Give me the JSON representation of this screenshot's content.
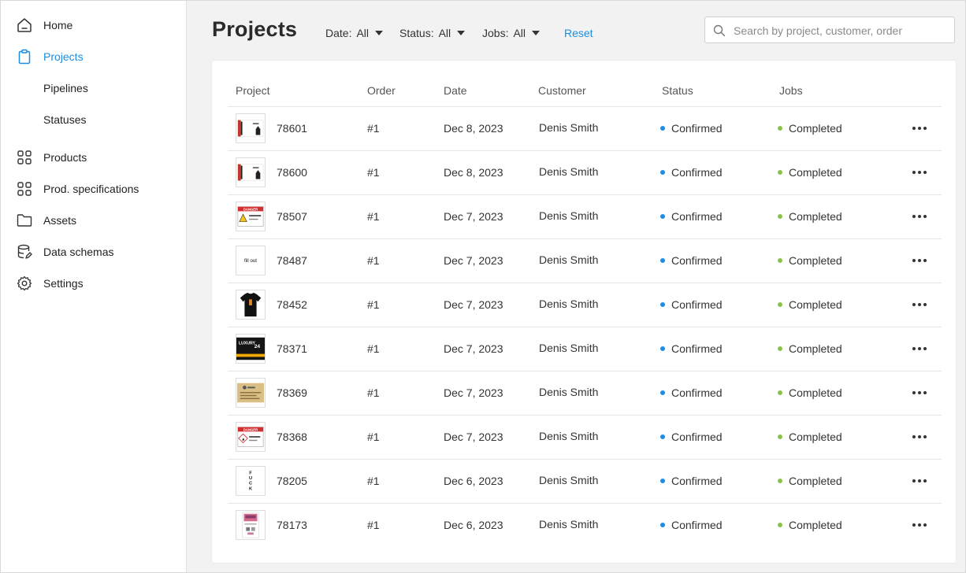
{
  "sidebar": {
    "items": [
      {
        "label": "Home",
        "icon": "home-icon"
      },
      {
        "label": "Projects",
        "icon": "clipboard-icon",
        "active": true
      },
      {
        "label": "Pipelines",
        "icon": ""
      },
      {
        "label": "Statuses",
        "icon": ""
      },
      {
        "label": "Products",
        "icon": "grid-icon"
      },
      {
        "label": "Prod. specifications",
        "icon": "grid-icon"
      },
      {
        "label": "Assets",
        "icon": "folder-icon"
      },
      {
        "label": "Data schemas",
        "icon": "database-icon"
      },
      {
        "label": "Settings",
        "icon": "gear-icon"
      }
    ]
  },
  "header": {
    "title": "Projects",
    "filters": [
      {
        "label": "Date:",
        "value": "All"
      },
      {
        "label": "Status:",
        "value": "All"
      },
      {
        "label": "Jobs:",
        "value": "All"
      }
    ],
    "reset_label": "Reset",
    "search_placeholder": "Search by project, customer, order"
  },
  "table": {
    "columns": [
      "Project",
      "Order",
      "Date",
      "Customer",
      "Status",
      "Jobs"
    ],
    "rows": [
      {
        "project": "78601",
        "thumb": "card",
        "order": "#1",
        "date": "Dec 8, 2023",
        "customer": "Denis Smith",
        "status": "Confirmed",
        "jobs": "Completed"
      },
      {
        "project": "78600",
        "thumb": "card",
        "order": "#1",
        "date": "Dec 8, 2023",
        "customer": "Denis Smith",
        "status": "Confirmed",
        "jobs": "Completed"
      },
      {
        "project": "78507",
        "thumb": "danger",
        "order": "#1",
        "date": "Dec 7, 2023",
        "customer": "Denis Smith",
        "status": "Confirmed",
        "jobs": "Completed"
      },
      {
        "project": "78487",
        "thumb": "fillout",
        "order": "#1",
        "date": "Dec 7, 2023",
        "customer": "Denis Smith",
        "status": "Confirmed",
        "jobs": "Completed"
      },
      {
        "project": "78452",
        "thumb": "tshirt",
        "order": "#1",
        "date": "Dec 7, 2023",
        "customer": "Denis Smith",
        "status": "Confirmed",
        "jobs": "Completed"
      },
      {
        "project": "78371",
        "thumb": "dark",
        "order": "#1",
        "date": "Dec 7, 2023",
        "customer": "Denis Smith",
        "status": "Confirmed",
        "jobs": "Completed"
      },
      {
        "project": "78369",
        "thumb": "gold",
        "order": "#1",
        "date": "Dec 7, 2023",
        "customer": "Denis Smith",
        "status": "Confirmed",
        "jobs": "Completed"
      },
      {
        "project": "78368",
        "thumb": "danger2",
        "order": "#1",
        "date": "Dec 7, 2023",
        "customer": "Denis Smith",
        "status": "Confirmed",
        "jobs": "Completed"
      },
      {
        "project": "78205",
        "thumb": "vertical",
        "order": "#1",
        "date": "Dec 6, 2023",
        "customer": "Denis Smith",
        "status": "Confirmed",
        "jobs": "Completed"
      },
      {
        "project": "78173",
        "thumb": "poster",
        "order": "#1",
        "date": "Dec 6, 2023",
        "customer": "Denis Smith",
        "status": "Confirmed",
        "jobs": "Completed"
      }
    ],
    "thumb_texts": {
      "fillout": "fill out",
      "dark": "LUXURY",
      "danger": "DANGER",
      "vertical": "F U C K"
    }
  },
  "colors": {
    "accent": "#1a8ee3",
    "status_dot": "#1a8ee3",
    "jobs_dot": "#8bc34a"
  }
}
